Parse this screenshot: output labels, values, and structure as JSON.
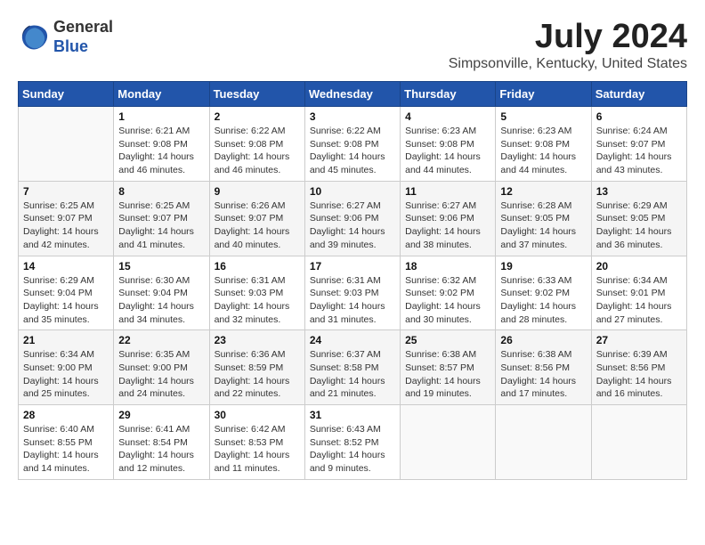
{
  "logo": {
    "general": "General",
    "blue": "Blue"
  },
  "title": "July 2024",
  "subtitle": "Simpsonville, Kentucky, United States",
  "days_of_week": [
    "Sunday",
    "Monday",
    "Tuesday",
    "Wednesday",
    "Thursday",
    "Friday",
    "Saturday"
  ],
  "weeks": [
    [
      {
        "day": "",
        "info": ""
      },
      {
        "day": "1",
        "info": "Sunrise: 6:21 AM\nSunset: 9:08 PM\nDaylight: 14 hours\nand 46 minutes."
      },
      {
        "day": "2",
        "info": "Sunrise: 6:22 AM\nSunset: 9:08 PM\nDaylight: 14 hours\nand 46 minutes."
      },
      {
        "day": "3",
        "info": "Sunrise: 6:22 AM\nSunset: 9:08 PM\nDaylight: 14 hours\nand 45 minutes."
      },
      {
        "day": "4",
        "info": "Sunrise: 6:23 AM\nSunset: 9:08 PM\nDaylight: 14 hours\nand 44 minutes."
      },
      {
        "day": "5",
        "info": "Sunrise: 6:23 AM\nSunset: 9:08 PM\nDaylight: 14 hours\nand 44 minutes."
      },
      {
        "day": "6",
        "info": "Sunrise: 6:24 AM\nSunset: 9:07 PM\nDaylight: 14 hours\nand 43 minutes."
      }
    ],
    [
      {
        "day": "7",
        "info": "Sunrise: 6:25 AM\nSunset: 9:07 PM\nDaylight: 14 hours\nand 42 minutes."
      },
      {
        "day": "8",
        "info": "Sunrise: 6:25 AM\nSunset: 9:07 PM\nDaylight: 14 hours\nand 41 minutes."
      },
      {
        "day": "9",
        "info": "Sunrise: 6:26 AM\nSunset: 9:07 PM\nDaylight: 14 hours\nand 40 minutes."
      },
      {
        "day": "10",
        "info": "Sunrise: 6:27 AM\nSunset: 9:06 PM\nDaylight: 14 hours\nand 39 minutes."
      },
      {
        "day": "11",
        "info": "Sunrise: 6:27 AM\nSunset: 9:06 PM\nDaylight: 14 hours\nand 38 minutes."
      },
      {
        "day": "12",
        "info": "Sunrise: 6:28 AM\nSunset: 9:05 PM\nDaylight: 14 hours\nand 37 minutes."
      },
      {
        "day": "13",
        "info": "Sunrise: 6:29 AM\nSunset: 9:05 PM\nDaylight: 14 hours\nand 36 minutes."
      }
    ],
    [
      {
        "day": "14",
        "info": "Sunrise: 6:29 AM\nSunset: 9:04 PM\nDaylight: 14 hours\nand 35 minutes."
      },
      {
        "day": "15",
        "info": "Sunrise: 6:30 AM\nSunset: 9:04 PM\nDaylight: 14 hours\nand 34 minutes."
      },
      {
        "day": "16",
        "info": "Sunrise: 6:31 AM\nSunset: 9:03 PM\nDaylight: 14 hours\nand 32 minutes."
      },
      {
        "day": "17",
        "info": "Sunrise: 6:31 AM\nSunset: 9:03 PM\nDaylight: 14 hours\nand 31 minutes."
      },
      {
        "day": "18",
        "info": "Sunrise: 6:32 AM\nSunset: 9:02 PM\nDaylight: 14 hours\nand 30 minutes."
      },
      {
        "day": "19",
        "info": "Sunrise: 6:33 AM\nSunset: 9:02 PM\nDaylight: 14 hours\nand 28 minutes."
      },
      {
        "day": "20",
        "info": "Sunrise: 6:34 AM\nSunset: 9:01 PM\nDaylight: 14 hours\nand 27 minutes."
      }
    ],
    [
      {
        "day": "21",
        "info": "Sunrise: 6:34 AM\nSunset: 9:00 PM\nDaylight: 14 hours\nand 25 minutes."
      },
      {
        "day": "22",
        "info": "Sunrise: 6:35 AM\nSunset: 9:00 PM\nDaylight: 14 hours\nand 24 minutes."
      },
      {
        "day": "23",
        "info": "Sunrise: 6:36 AM\nSunset: 8:59 PM\nDaylight: 14 hours\nand 22 minutes."
      },
      {
        "day": "24",
        "info": "Sunrise: 6:37 AM\nSunset: 8:58 PM\nDaylight: 14 hours\nand 21 minutes."
      },
      {
        "day": "25",
        "info": "Sunrise: 6:38 AM\nSunset: 8:57 PM\nDaylight: 14 hours\nand 19 minutes."
      },
      {
        "day": "26",
        "info": "Sunrise: 6:38 AM\nSunset: 8:56 PM\nDaylight: 14 hours\nand 17 minutes."
      },
      {
        "day": "27",
        "info": "Sunrise: 6:39 AM\nSunset: 8:56 PM\nDaylight: 14 hours\nand 16 minutes."
      }
    ],
    [
      {
        "day": "28",
        "info": "Sunrise: 6:40 AM\nSunset: 8:55 PM\nDaylight: 14 hours\nand 14 minutes."
      },
      {
        "day": "29",
        "info": "Sunrise: 6:41 AM\nSunset: 8:54 PM\nDaylight: 14 hours\nand 12 minutes."
      },
      {
        "day": "30",
        "info": "Sunrise: 6:42 AM\nSunset: 8:53 PM\nDaylight: 14 hours\nand 11 minutes."
      },
      {
        "day": "31",
        "info": "Sunrise: 6:43 AM\nSunset: 8:52 PM\nDaylight: 14 hours\nand 9 minutes."
      },
      {
        "day": "",
        "info": ""
      },
      {
        "day": "",
        "info": ""
      },
      {
        "day": "",
        "info": ""
      }
    ]
  ]
}
